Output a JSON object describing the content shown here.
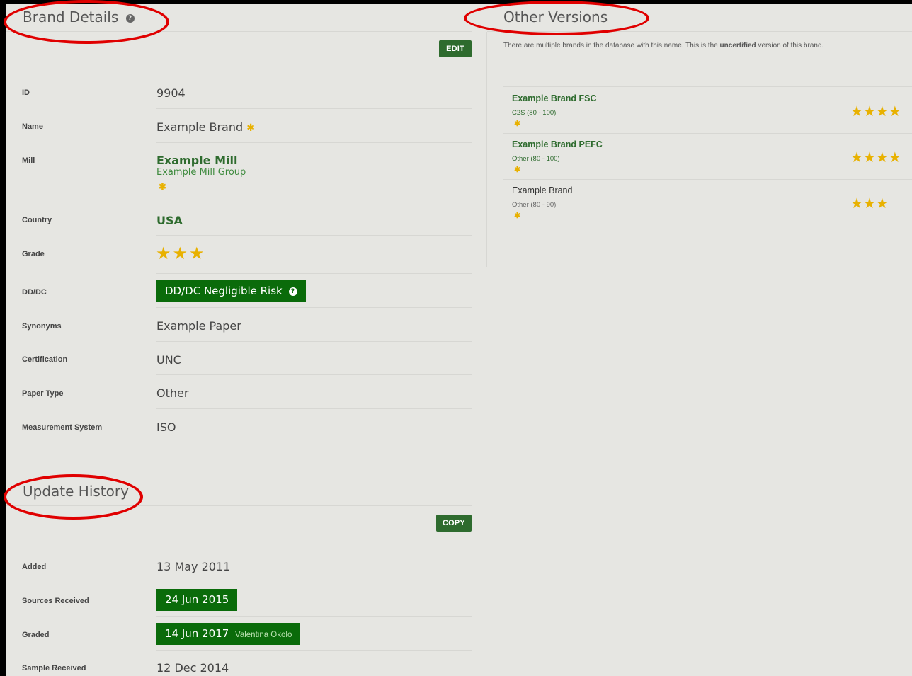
{
  "brand_details": {
    "title": "Brand Details",
    "edit_label": "EDIT",
    "rows": [
      {
        "label": "ID",
        "value": "9904"
      },
      {
        "label": "Name",
        "value": "Example Brand"
      },
      {
        "label": "Mill",
        "value": "Example Mill",
        "sub": "Example Mill Group"
      },
      {
        "label": "Country",
        "value": "USA"
      },
      {
        "label": "Grade",
        "stars": 3
      },
      {
        "label": "DD/DC",
        "value": "DD/DC Negligible Risk"
      },
      {
        "label": "Synonyms",
        "value": "Example Paper"
      },
      {
        "label": "Certification",
        "value": "UNC"
      },
      {
        "label": "Paper Type",
        "value": "Other"
      },
      {
        "label": "Measurement System",
        "value": "ISO"
      }
    ]
  },
  "other_versions": {
    "title": "Other Versions",
    "notice_before": "There are multiple brands in the database with this name. This is the ",
    "notice_bold": "uncertified",
    "notice_after": " version of this brand.",
    "items": [
      {
        "name": "Example Brand FSC",
        "sub": "C2S (80 - 100)",
        "stars": 4
      },
      {
        "name": "Example Brand PEFC",
        "sub": "Other (80 - 100)",
        "stars": 4
      },
      {
        "name": "Example Brand",
        "sub": "Other (80 - 90)",
        "stars": 3
      }
    ]
  },
  "update_history": {
    "title": "Update History",
    "copy_label": "COPY",
    "rows": [
      {
        "label": "Added",
        "value": "13 May 2011"
      },
      {
        "label": "Sources Received",
        "value": "24 Jun 2015"
      },
      {
        "label": "Graded",
        "value": "14 Jun 2017",
        "by": "Valentina Okolo"
      },
      {
        "label": "Sample Received",
        "value": "12 Dec 2014"
      }
    ]
  },
  "symbols": {
    "asterisk": "✱",
    "star": "★",
    "help": "?"
  },
  "colors": {
    "accent_green": "#2e6b2e",
    "badge_green": "#0a6b0a",
    "star_gold": "#e8b100",
    "annotation_red": "#e00000"
  }
}
